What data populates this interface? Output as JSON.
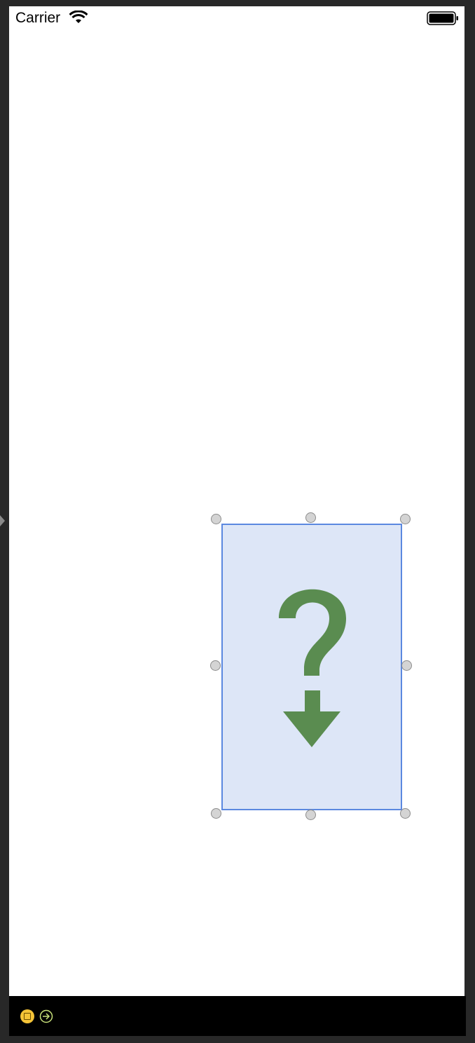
{
  "status_bar": {
    "carrier": "Carrier",
    "wifi_icon": "wifi-icon",
    "battery_icon": "battery-icon"
  },
  "canvas": {
    "background": "#ffffff",
    "selected_view": {
      "type": "image-view",
      "placeholder_icon": "question-mark-down-arrow-icon",
      "fill": "#dde6f7",
      "border": "#5b88e0",
      "icon_color": "#5a8c50"
    }
  },
  "scene_dock": {
    "icons": [
      "view-controller-icon",
      "exit-icon"
    ],
    "view_controller_color": "#f5c437",
    "exit_color": "#c8e07a"
  }
}
